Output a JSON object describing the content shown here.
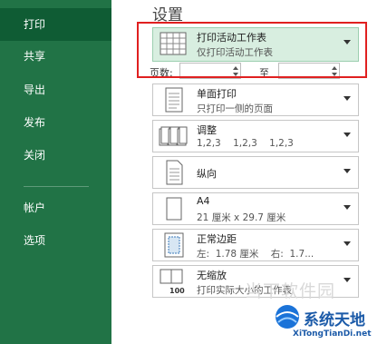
{
  "sidebar": {
    "items": [
      {
        "label": "打印",
        "active": true
      },
      {
        "label": "共享"
      },
      {
        "label": "导出"
      },
      {
        "label": "发布"
      },
      {
        "label": "关闭"
      },
      {
        "label": "帐户"
      },
      {
        "label": "选项"
      }
    ]
  },
  "main": {
    "title": "设置",
    "scope": {
      "label": "打印活动工作表",
      "sublabel": "仅打印活动工作表",
      "icon": "sheet-grid-icon"
    },
    "pages": {
      "from_label": "页数:",
      "to_label": "至",
      "from_value": "",
      "to_value": ""
    },
    "sides": {
      "label": "单面打印",
      "sublabel": "只打印一侧的页面",
      "icon": "single-page-icon"
    },
    "collate": {
      "label": "调整",
      "sublabel": "1,2,3    1,2,3    1,2,3",
      "icon": "collate-icon"
    },
    "orientation": {
      "label": "纵向",
      "icon": "portrait-icon"
    },
    "paper": {
      "label": "A4",
      "sublabel": "21 厘米 x 29.7 厘米",
      "icon": "paper-icon"
    },
    "margins": {
      "label": "正常边距",
      "sublabel": "左:  1.78 厘米    右:  1.7...",
      "icon": "margins-icon"
    },
    "scaling": {
      "label": "无缩放",
      "sublabel": "打印实际大小的工作表",
      "icon": "scale-100-icon",
      "icon_text": "100"
    }
  },
  "watermark": {
    "text": "当下软件园",
    "brand": "系统天地",
    "url": "XiTongTianDi.net"
  },
  "colors": {
    "sidebar": "#217346",
    "sidebar_active": "#0f5c34",
    "highlight": "#d8eee0",
    "callout": "#e02020"
  }
}
